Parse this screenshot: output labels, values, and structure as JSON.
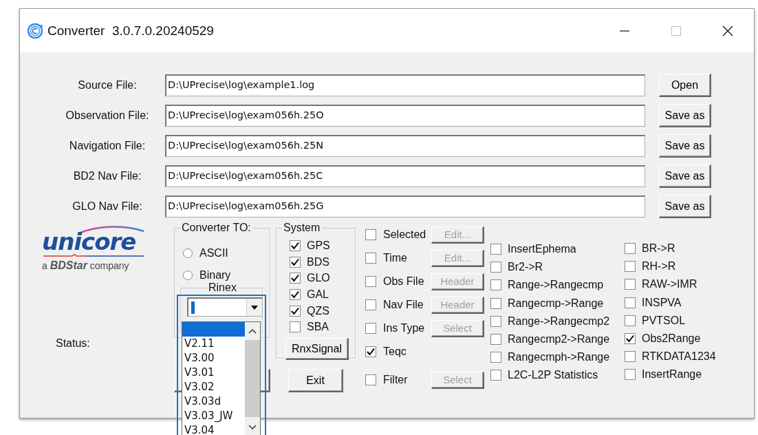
{
  "window": {
    "title": "Converter  3.0.7.0.20240529",
    "maximize_disabled": true
  },
  "files": [
    {
      "label": "Source File:",
      "value": "D:\\UPrecise\\log\\example1.log",
      "button": "Open"
    },
    {
      "label": "Observation File:",
      "value": "D:\\UPrecise\\log\\exam056h.25O",
      "button": "Save as"
    },
    {
      "label": "Navigation File:",
      "value": "D:\\UPrecise\\log\\exam056h.25N",
      "button": "Save as"
    },
    {
      "label": "BD2 Nav File:",
      "value": "D:\\UPrecise\\log\\exam056h.25C",
      "button": "Save as"
    },
    {
      "label": "GLO Nav File:",
      "value": "D:\\UPrecise\\log\\exam056h.25G",
      "button": "Save as"
    }
  ],
  "logo": {
    "wordmark": "unicore",
    "tagline": "a **BDStar** company"
  },
  "status": {
    "label": "Status:"
  },
  "converter_to": {
    "title": "Converter TO:",
    "options": [
      {
        "label": "ASCII",
        "selected": false
      },
      {
        "label": "Binary",
        "selected": false
      }
    ],
    "rinex": {
      "title": "Rinex",
      "blank_selected": true,
      "options": [
        "V2.11",
        "V3.00",
        "V3.01",
        "V3.02",
        "V3.03d",
        "V3.03_JW",
        "V3.04"
      ]
    }
  },
  "system": {
    "title": "System",
    "items": [
      {
        "label": "GPS",
        "checked": true
      },
      {
        "label": "BDS",
        "checked": true
      },
      {
        "label": "GLO",
        "checked": true
      },
      {
        "label": "GAL",
        "checked": true
      },
      {
        "label": "QZS",
        "checked": true
      },
      {
        "label": "SBA",
        "checked": false
      }
    ],
    "button": "RnxSignal"
  },
  "exit_button": "Exit",
  "options": [
    {
      "label": "Selected",
      "checked": false,
      "button": {
        "label": "Edit...",
        "disabled": true
      }
    },
    {
      "label": "Time",
      "checked": false,
      "button": {
        "label": "Edit...",
        "disabled": true
      }
    },
    {
      "label": "Obs File",
      "checked": false,
      "button": {
        "label": "Header",
        "disabled": true
      }
    },
    {
      "label": "Nav File",
      "checked": false,
      "button": {
        "label": "Header",
        "disabled": true
      }
    },
    {
      "label": "Ins Type",
      "checked": false,
      "button": {
        "label": "Select",
        "disabled": true
      }
    },
    {
      "label": "Teqc",
      "checked": true
    },
    {
      "label": "Filter",
      "checked": false,
      "button": {
        "label": "Select",
        "disabled": true
      }
    }
  ],
  "conversions": [
    {
      "label": "InsertEphema",
      "checked": false
    },
    {
      "label": "Br2->R",
      "checked": false
    },
    {
      "label": "Range->Rangecmp",
      "checked": false
    },
    {
      "label": "Rangecmp->Range",
      "checked": false
    },
    {
      "label": "Range->Rangecmp2",
      "checked": false
    },
    {
      "label": "Rangecmp2->Range",
      "checked": false
    },
    {
      "label": "Rangecmph->Range",
      "checked": false
    },
    {
      "label": "L2C-L2P Statistics",
      "checked": false
    }
  ],
  "outputs": [
    {
      "label": "BR->R",
      "checked": false
    },
    {
      "label": "RH->R",
      "checked": false
    },
    {
      "label": "RAW->IMR",
      "checked": false
    },
    {
      "label": "INSPVA",
      "checked": false
    },
    {
      "label": "PVTSOL",
      "checked": false
    },
    {
      "label": "Obs2Range",
      "checked": true
    },
    {
      "label": "RTKDATA1234",
      "checked": false
    },
    {
      "label": "InsertRange",
      "checked": false
    }
  ]
}
